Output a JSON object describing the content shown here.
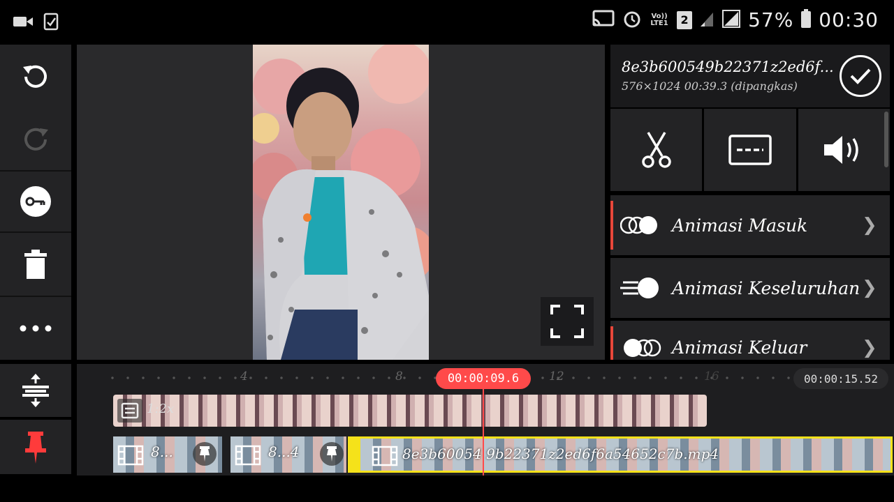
{
  "status_bar": {
    "volte_label": "Vo)) LTE1",
    "sim_label": "2",
    "battery": "57%",
    "time": "00:30"
  },
  "left_toolbar": {
    "items": [
      {
        "name": "undo"
      },
      {
        "name": "redo",
        "disabled": true
      },
      {
        "name": "keyframe"
      },
      {
        "name": "delete"
      },
      {
        "name": "more"
      }
    ]
  },
  "clip_panel": {
    "clip_name": "8e3b600549b22371z2ed6f...",
    "clip_info": "576×1024 00:39.3 (dipangkas)",
    "tools": [
      "split",
      "caption",
      "volume"
    ],
    "menu": [
      {
        "label": "Animasi Masuk",
        "accent": true
      },
      {
        "label": "Animasi Keseluruhan",
        "accent": false
      },
      {
        "label": "Animasi Keluar",
        "accent": true
      }
    ]
  },
  "timeline": {
    "current_time": "00:00:09.6",
    "total_duration": "00:00:15.52",
    "ruler_marks": [
      "4",
      "8",
      "12",
      "16"
    ],
    "overlay_track_label": "1:2x",
    "clips": [
      {
        "label": "8..."
      },
      {
        "label": "8...4"
      },
      {
        "label": "8e3b60054 9b22371z2ed6f6a54652c7b.mp4",
        "selected": true
      }
    ]
  },
  "colors": {
    "accent_red": "#ff4a4a",
    "selected_yellow": "#f5e21a",
    "panel_bg": "#232325"
  }
}
